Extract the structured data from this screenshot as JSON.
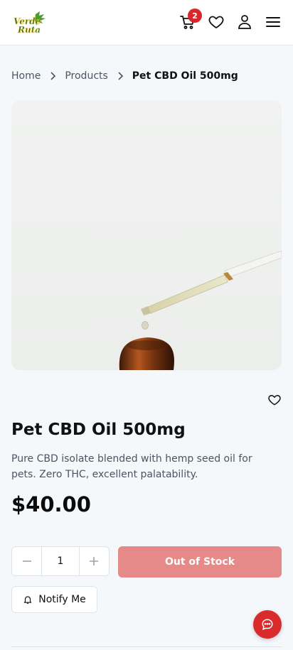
{
  "header": {
    "logo_text": "Verde Ruta",
    "cart_count": "2",
    "icons": [
      "cart-icon",
      "heart-icon",
      "user-icon",
      "menu-icon"
    ]
  },
  "breadcrumb": {
    "home": "Home",
    "products": "Products",
    "current": "Pet CBD Oil 500mg"
  },
  "product": {
    "title": "Pet CBD Oil 500mg",
    "description": "Pure CBD isolate blended with hemp seed oil for pets. Zero THC, excellent palatability.",
    "price": "$40.00",
    "quantity": "1",
    "stock_button": "Out of Stock",
    "notify_button": "Notify Me"
  },
  "colors": {
    "accent": "#d9262a",
    "out_of_stock": "#e58a88",
    "brand_green": "#3f8f2a"
  }
}
